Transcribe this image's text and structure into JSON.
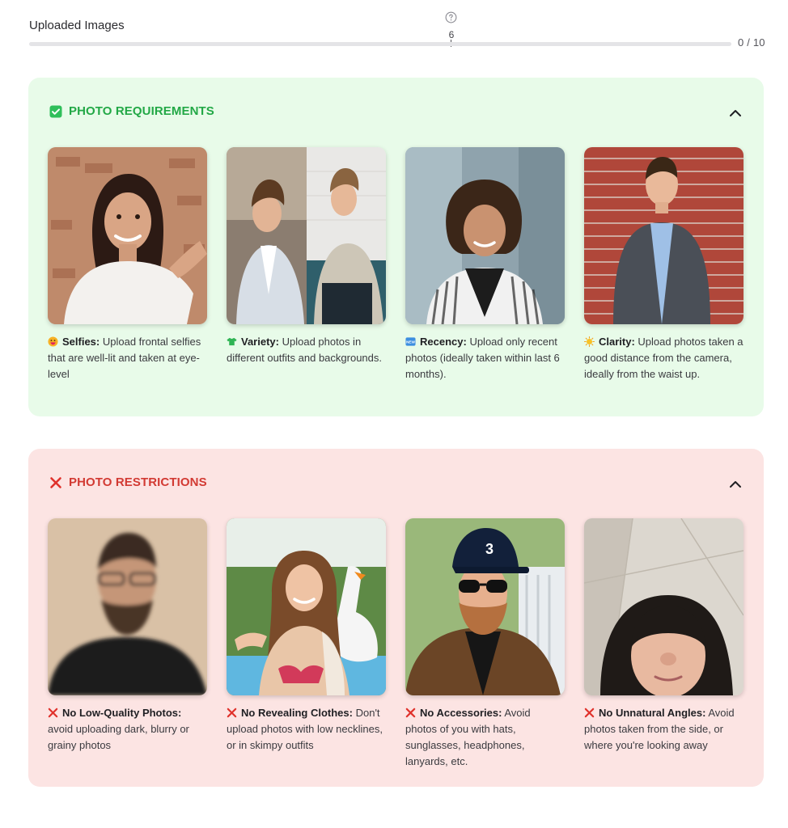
{
  "progress": {
    "title": "Uploaded Images",
    "marker_value": "6",
    "count_label": "0 / 10",
    "fraction": 0
  },
  "requirements": {
    "title": "PHOTO REQUIREMENTS",
    "accent": "#22a846",
    "background": "#e8fbe9",
    "cards": [
      {
        "icon": "grinning-face-icon",
        "title": "Selfies:",
        "text": "Upload frontal selfies that are well-lit and taken at eye-level"
      },
      {
        "icon": "tshirt-icon",
        "title": "Variety:",
        "text": "Upload photos in different outfits and backgrounds."
      },
      {
        "icon": "new-badge-icon",
        "title": "Recency:",
        "text": "Upload only recent photos (ideally taken within last 6 months)."
      },
      {
        "icon": "sun-icon",
        "title": "Clarity:",
        "text": "Upload photos taken a good distance from the camera, ideally from the waist up."
      }
    ]
  },
  "restrictions": {
    "title": "PHOTO RESTRICTIONS",
    "accent": "#d23a33",
    "background": "#fce4e3",
    "cards": [
      {
        "icon": "cross-mark-icon",
        "title": "No Low-Quality Photos:",
        "text": "avoid uploading dark, blurry or grainy photos"
      },
      {
        "icon": "cross-mark-icon",
        "title": "No Revealing Clothes:",
        "text": "Don't upload photos with low necklines, or in skimpy outfits"
      },
      {
        "icon": "cross-mark-icon",
        "title": "No Accessories:",
        "text": "Avoid photos of you with hats, sunglasses, headphones, lanyards, etc."
      },
      {
        "icon": "cross-mark-icon",
        "title": "No Unnatural Angles:",
        "text": "Avoid photos taken from the side, or where you're looking away"
      }
    ]
  }
}
